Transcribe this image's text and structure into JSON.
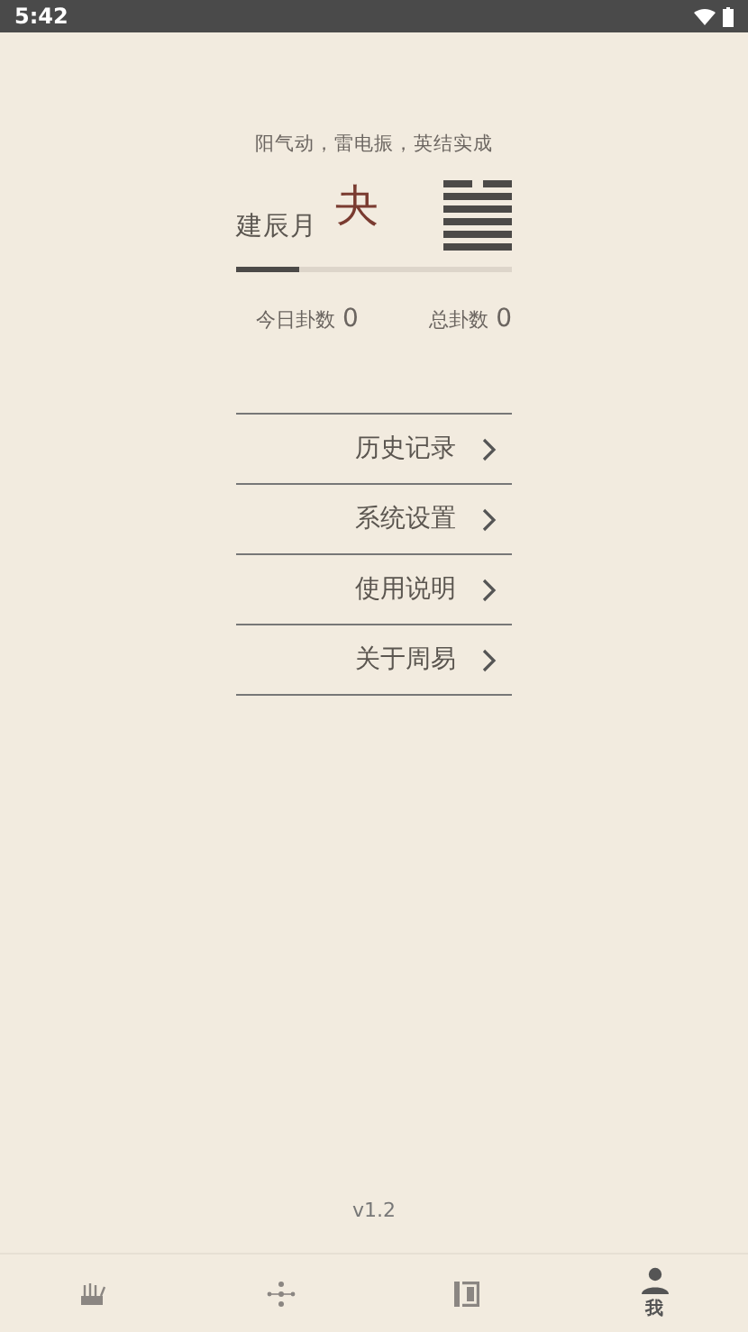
{
  "status_bar": {
    "time": "5:42"
  },
  "header": {
    "verse": "阳气动，雷电振，英结实成",
    "month": "建辰月",
    "hexagram_name": "夬",
    "hexagram_lines": [
      {
        "kind": "yin"
      },
      {
        "kind": "yang"
      },
      {
        "kind": "yang"
      },
      {
        "kind": "yang"
      },
      {
        "kind": "yang"
      },
      {
        "kind": "yang"
      }
    ],
    "progress": {
      "level": 0.23
    }
  },
  "stats": [
    {
      "label": "今日卦数",
      "value": "0"
    },
    {
      "label": "总卦数",
      "value": "0"
    }
  ],
  "menu": [
    {
      "label": "历史记录"
    },
    {
      "label": "系统设置"
    },
    {
      "label": "使用说明"
    },
    {
      "label": "关于周易"
    }
  ],
  "version": "v1.2",
  "bottom_nav": [
    {
      "kind": "sticks",
      "selected": false
    },
    {
      "kind": "dots",
      "selected": false
    },
    {
      "kind": "book",
      "selected": false
    },
    {
      "kind": "person",
      "label": "我",
      "selected": true
    }
  ]
}
